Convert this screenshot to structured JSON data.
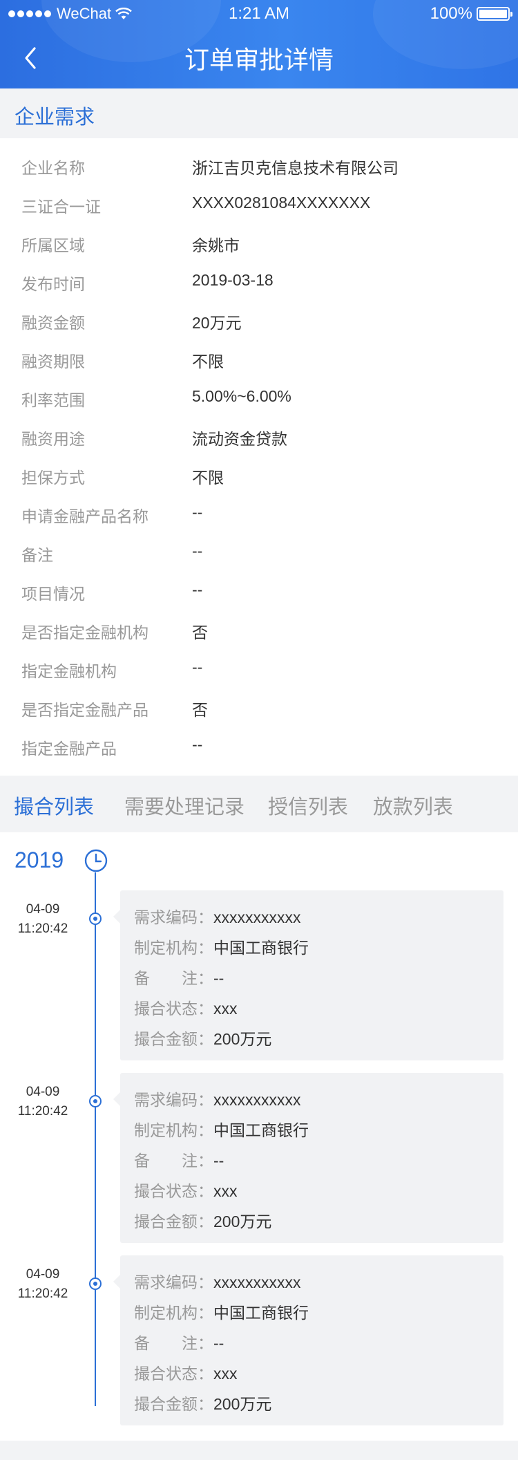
{
  "status_bar": {
    "carrier": "WeChat",
    "time": "1:21 AM",
    "battery_text": "100%",
    "battery_level": 1.0
  },
  "nav": {
    "title": "订单审批详情",
    "back_icon": "chevron-left-icon"
  },
  "section": {
    "title": "企业需求"
  },
  "info_rows": [
    {
      "label": "企业名称",
      "value": "浙江吉贝克信息技术有限公司"
    },
    {
      "label": "三证合一证",
      "value": "XXXX0281084XXXXXXX"
    },
    {
      "label": "所属区域",
      "value": "余姚市"
    },
    {
      "label": "发布时间",
      "value": "2019-03-18"
    },
    {
      "label": "融资金额",
      "value": "20万元"
    },
    {
      "label": "融资期限",
      "value": "不限"
    },
    {
      "label": "利率范围",
      "value": "5.00%~6.00%"
    },
    {
      "label": "融资用途",
      "value": "流动资金贷款"
    },
    {
      "label": "担保方式",
      "value": "不限"
    },
    {
      "label": "申请金融产品名称",
      "value": "--"
    },
    {
      "label": "备注",
      "value": "--"
    },
    {
      "label": "项目情况",
      "value": "--"
    },
    {
      "label": "是否指定金融机构",
      "value": "否"
    },
    {
      "label": "指定金融机构",
      "value": "--"
    },
    {
      "label": "是否指定金融产品",
      "value": "否"
    },
    {
      "label": "指定金融产品",
      "value": "--"
    }
  ],
  "tabs": [
    {
      "label": "撮合列表",
      "active": true
    },
    {
      "label": "需要处理记录",
      "active": false
    },
    {
      "label": "授信列表",
      "active": false
    },
    {
      "label": "放款列表",
      "active": false
    }
  ],
  "timeline": {
    "year": "2019",
    "clock_icon": "clock-icon",
    "entries": [
      {
        "date": "04-09",
        "time": "11:20:42",
        "fields": [
          {
            "key": "需求编码：",
            "value": "xxxxxxxxxxx"
          },
          {
            "key": "制定机构：",
            "value": "中国工商银行"
          },
          {
            "key": "备　　注：",
            "value": "--"
          },
          {
            "key": "撮合状态：",
            "value": "xxx"
          },
          {
            "key": "撮合金额：",
            "value": "200万元"
          }
        ]
      },
      {
        "date": "04-09",
        "time": "11:20:42",
        "fields": [
          {
            "key": "需求编码：",
            "value": "xxxxxxxxxxx"
          },
          {
            "key": "制定机构：",
            "value": "中国工商银行"
          },
          {
            "key": "备　　注：",
            "value": "--"
          },
          {
            "key": "撮合状态：",
            "value": "xxx"
          },
          {
            "key": "撮合金额：",
            "value": "200万元"
          }
        ]
      },
      {
        "date": "04-09",
        "time": "11:20:42",
        "fields": [
          {
            "key": "需求编码：",
            "value": "xxxxxxxxxxx"
          },
          {
            "key": "制定机构：",
            "value": "中国工商银行"
          },
          {
            "key": "备　　注：",
            "value": "--"
          },
          {
            "key": "撮合状态：",
            "value": "xxx"
          },
          {
            "key": "撮合金额：",
            "value": "200万元"
          }
        ]
      }
    ]
  },
  "colors": {
    "primary": "#2b6fd6",
    "header_from": "#2c6ee0",
    "header_to": "#3a86ef",
    "label_gray": "#999999",
    "text": "#333333",
    "page_bg": "#f2f3f5",
    "card_bg": "#f1f2f4"
  }
}
